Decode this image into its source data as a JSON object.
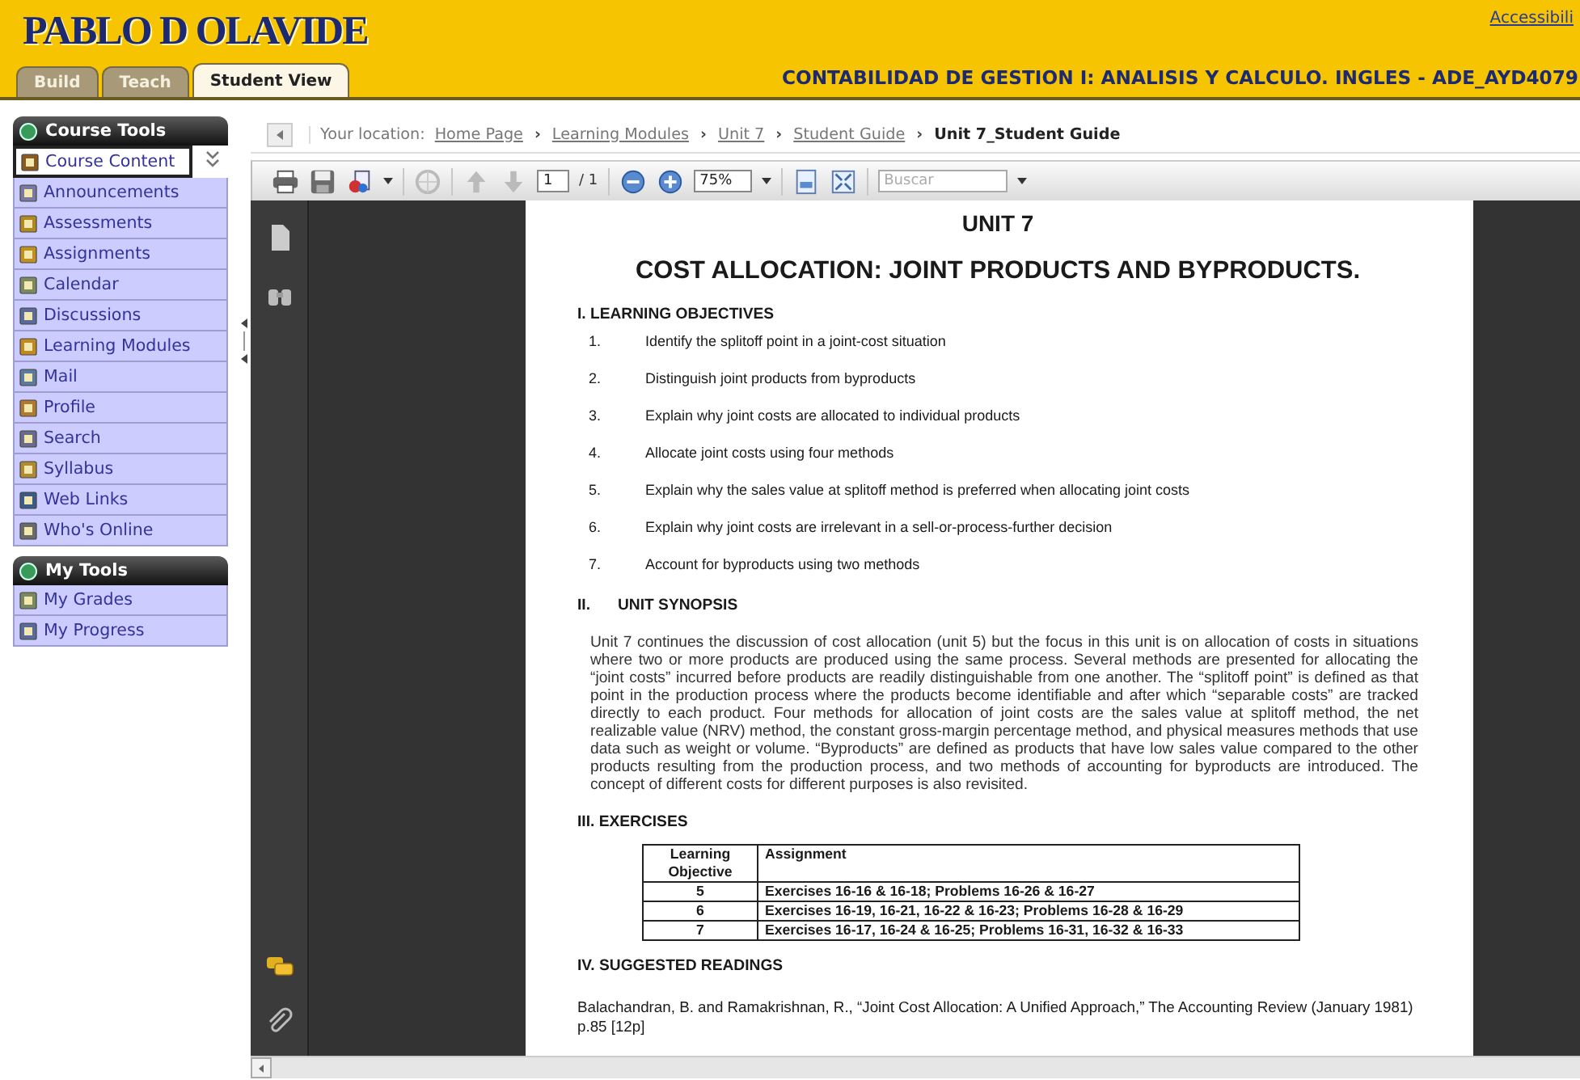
{
  "header": {
    "logo": "PABLO D OLAVIDE",
    "accessibility_link": "Accessibili",
    "course_title": "CONTABILIDAD DE GESTION I: ANALISIS Y CALCULO. INGLES - ADE_AYD4079",
    "tabs": [
      {
        "label": "Build",
        "selected": false
      },
      {
        "label": "Teach",
        "selected": false
      },
      {
        "label": "Student View",
        "selected": true
      }
    ]
  },
  "sidebar": {
    "sections": [
      {
        "title": "Course Tools",
        "items": [
          {
            "label": "Course Content",
            "selected": true
          },
          {
            "label": "Announcements",
            "selected": false
          },
          {
            "label": "Assessments",
            "selected": false
          },
          {
            "label": "Assignments",
            "selected": false
          },
          {
            "label": "Calendar",
            "selected": false
          },
          {
            "label": "Discussions",
            "selected": false
          },
          {
            "label": "Learning Modules",
            "selected": false
          },
          {
            "label": "Mail",
            "selected": false
          },
          {
            "label": "Profile",
            "selected": false
          },
          {
            "label": "Search",
            "selected": false
          },
          {
            "label": "Syllabus",
            "selected": false
          },
          {
            "label": "Web Links",
            "selected": false
          },
          {
            "label": "Who's Online",
            "selected": false
          }
        ]
      },
      {
        "title": "My Tools",
        "items": [
          {
            "label": "My Grades",
            "selected": false
          },
          {
            "label": "My Progress",
            "selected": false
          }
        ]
      }
    ]
  },
  "location": {
    "label": "Your location:",
    "items": [
      {
        "text": "Home Page",
        "kind": "link",
        "separator": "›"
      },
      {
        "text": "Learning Modules",
        "kind": "link",
        "separator": "›"
      },
      {
        "text": "Unit 7",
        "kind": "link",
        "separator": "›"
      },
      {
        "text": "Student Guide",
        "kind": "link",
        "separator": "›"
      },
      {
        "text": "Unit 7_Student Guide",
        "kind": "current"
      }
    ]
  },
  "pdf_toolbar": {
    "page": "1",
    "page_total": "/ 1",
    "zoom": "75%",
    "search": {
      "placeholder": "Buscar"
    }
  },
  "document": {
    "unit": "UNIT 7",
    "title": "COST ALLOCATION: JOINT PRODUCTS AND BYPRODUCTS.",
    "objectives": {
      "heading": "I. LEARNING OBJECTIVES",
      "items": [
        {
          "number": "1.",
          "text": "Identify the splitoff point in a joint-cost situation"
        },
        {
          "number": "2.",
          "text": "Distinguish joint products from byproducts"
        },
        {
          "number": "3.",
          "text": "Explain why joint costs are allocated to individual products"
        },
        {
          "number": "4.",
          "text": "Allocate joint costs using four methods"
        },
        {
          "number": "5.",
          "text": "Explain why the sales value at splitoff method is preferred when allocating joint costs"
        },
        {
          "number": "6.",
          "text": "Explain why joint costs are irrelevant in a sell-or-process-further decision"
        },
        {
          "number": "7.",
          "text": "Account for byproducts using two methods"
        }
      ]
    },
    "synopsis": {
      "number": "II.",
      "heading": "UNIT SYNOPSIS",
      "text": "Unit 7 continues the discussion of cost allocation (unit 5) but the focus in this unit is on allocation of costs in situations where two or more products are produced using the same process. Several methods are presented for allocating the “joint costs” incurred before products are readily distinguishable from one another. The “splitoff point” is defined as that point in the production process where the products become identifiable and after which “separable costs” are tracked directly to each product. Four methods for allocation of joint costs are the sales value at splitoff method, the net realizable value (NRV) method, the constant gross-margin percentage method, and physical measures methods that use data such as weight or volume. “Byproducts” are defined as products that have low sales value compared to the other products resulting from the production process, and two methods of accounting for byproducts are introduced. The concept of different costs for different purposes is also revisited."
    },
    "exercises": {
      "heading": "III. EXERCISES",
      "columns": [
        "Learning Objective",
        "Assignment"
      ],
      "rows": [
        [
          "5",
          "Exercises 16-16 & 16-18; Problems 16-26 & 16-27"
        ],
        [
          "6",
          "Exercises 16-19, 16-21, 16-22 & 16-23; Problems 16-28 & 16-29"
        ],
        [
          "7",
          "Exercises 16-17, 16-24 & 16-25; Problems 16-31, 16-32 & 16-33"
        ]
      ]
    },
    "readings": {
      "heading": "IV. SUGGESTED READINGS",
      "items": [
        "Balachandran, B. and Ramakrishnan, R., “Joint Cost Allocation: A Unified Approach,” The Accounting Review (January 1981) p.85 [12p]"
      ]
    }
  }
}
